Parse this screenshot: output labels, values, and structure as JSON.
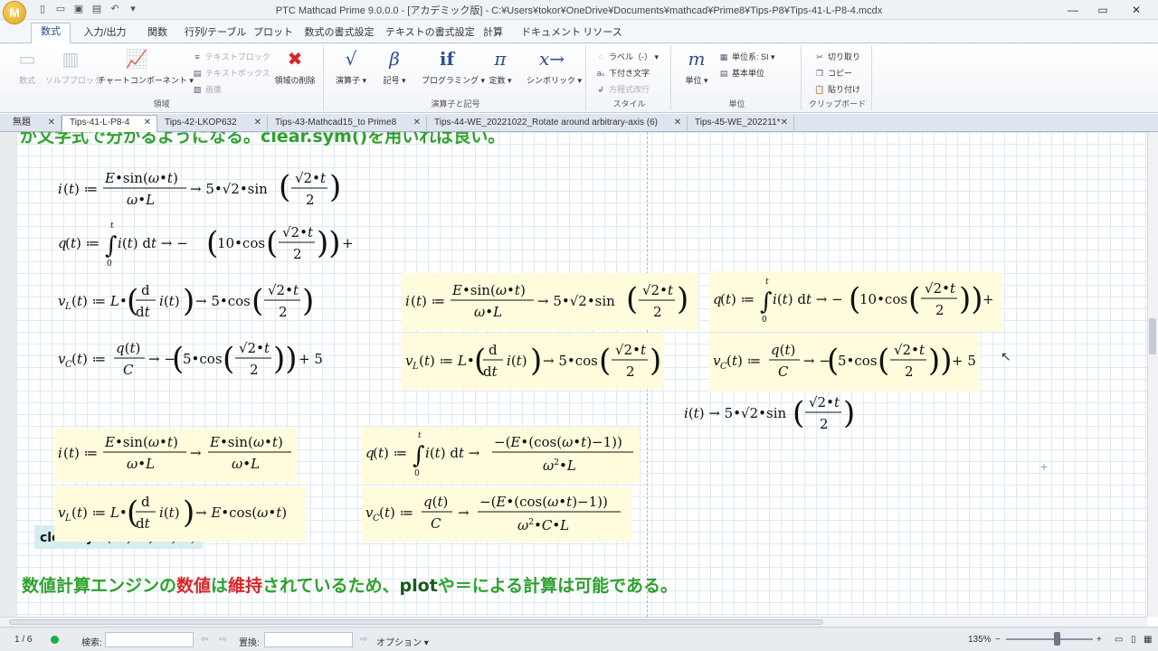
{
  "window": {
    "logo": "M",
    "title": "PTC Mathcad Prime 9.0.0.0 - [アカデミック版] - C:¥Users¥tokor¥OneDrive¥Documents¥mathcad¥Prime8¥Tips-P8¥Tips-41-L-P8-4.mcdx",
    "controls": [
      "—",
      "▭",
      "✕"
    ]
  },
  "ribbon_tabs": [
    "数式",
    "入力/出力",
    "関数",
    "行列/テーブル",
    "プロット",
    "数式の書式設定",
    "テキストの書式設定",
    "計算",
    "ドキュメント",
    "リソース"
  ],
  "ribbon": {
    "regions": {
      "label": "領域",
      "math": "数式",
      "solve_block": "ソルブブロック",
      "chart_component": "チャートコンポーネント",
      "text_block": "テキストブロック",
      "text_box": "テキストボックス",
      "image": "画像",
      "delete_region": "領域の削除"
    },
    "operators": {
      "label": "演算子と記号",
      "operators": "演算子",
      "symbols": "記号",
      "programming": "プログラミング",
      "constants": "定数",
      "symbolics": "シンボリック"
    },
    "style": {
      "label": "スタイル",
      "label_dropdown": "ラベル（-）",
      "subscript": "下付き文字",
      "eq_wrap": "方程式改行"
    },
    "units": {
      "label": "単位",
      "units": "単位",
      "unit_system": "単位系: SI",
      "base_units": "基本単位"
    },
    "clipboard": {
      "label": "クリップボード",
      "cut": "切り取り",
      "copy": "コピー",
      "paste": "貼り付け"
    }
  },
  "doc_tabs": [
    "無題",
    "Tips-41-L-P8-4",
    "Tips-42-LKOP632",
    "Tips-43-Mathcad15_to Prime8",
    "Tips-44-WE_20221022_Rotate around arbitrary-axis (6)",
    "Tips-45-WE_202211*"
  ],
  "sheet": {
    "heading_top": "が文字式で分かるようになる。clear.sym()を用いれば良い。",
    "clear_sym": {
      "fn": "clear.sym",
      "args": "(C , L , E , ω)"
    },
    "bottom_text": {
      "p1": "数値計算エンジンの",
      "p2": "数値",
      "p3": "は",
      "p4": "維持",
      "p5": "されているため、",
      "p6": "plot",
      "p7": "や＝による計算は可能である。"
    }
  },
  "status": {
    "page": "1 / 6",
    "search_label": "検索:",
    "search_value": "",
    "replace_label": "置換:",
    "replace_value": "",
    "options": "オプション",
    "zoom": "135%"
  },
  "colors": {
    "accent": "#2c6bd1",
    "heading_green": "#2ea12e",
    "heading_red": "#d8262a",
    "highlight": "#fffbdd"
  }
}
